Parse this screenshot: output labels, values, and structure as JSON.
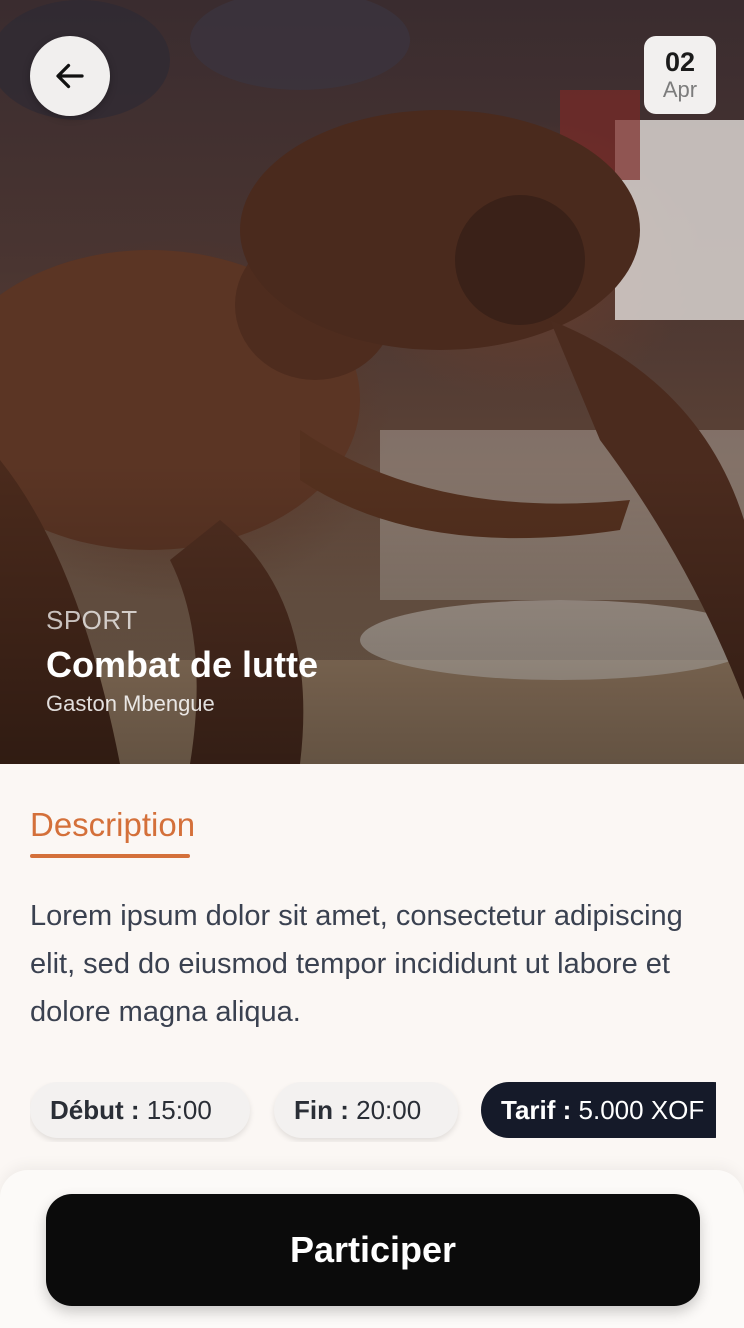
{
  "header": {
    "back_icon": "arrow-left-icon",
    "date": {
      "day": "02",
      "month": "Apr"
    }
  },
  "event": {
    "category": "SPORT",
    "title": "Combat de lutte",
    "organizer": "Gaston Mbengue",
    "hero_image": "wrestling-photo"
  },
  "tabs": {
    "description_label": "Description"
  },
  "description": "Lorem ipsum dolor sit amet, consectetur adipiscing elit, sed do eiusmod tempor incididunt ut labore et dolore magna aliqua.",
  "info_chips": {
    "start": {
      "label": "Début :",
      "value": "15:00"
    },
    "end": {
      "label": "Fin :",
      "value": "20:00"
    },
    "price": {
      "label": "Tarif :",
      "value": "5.000 XOF"
    }
  },
  "cta": {
    "label": "Participer"
  },
  "colors": {
    "accent": "#d4703a",
    "dark_chip": "#151a29",
    "cta": "#0b0b0b",
    "background": "#fbf7f4"
  }
}
